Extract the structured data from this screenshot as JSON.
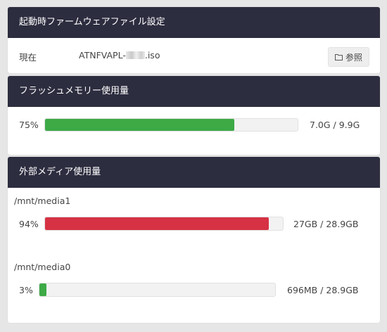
{
  "boot_panel": {
    "title": "起動時ファームウェアファイル設定",
    "current_label": "現在",
    "file_prefix": "ATNFVAPL-",
    "file_suffix": ".iso",
    "browse_label": "参照"
  },
  "flash_panel": {
    "title": "フラッシュメモリー使用量",
    "percent_text": "75%",
    "percent": 75,
    "usage_text": "7.0G / 9.9G",
    "bar_color": "#3daa46"
  },
  "media_panel": {
    "title": "外部メディア使用量",
    "items": [
      {
        "mount": "/mnt/media1",
        "percent_text": "94%",
        "percent": 94,
        "usage_text": "27GB / 28.9GB",
        "bar_color": "#d63244"
      },
      {
        "mount": "/mnt/media0",
        "percent_text": "3%",
        "percent": 3,
        "usage_text": "696MB / 28.9GB",
        "bar_color": "#3daa46"
      }
    ]
  }
}
